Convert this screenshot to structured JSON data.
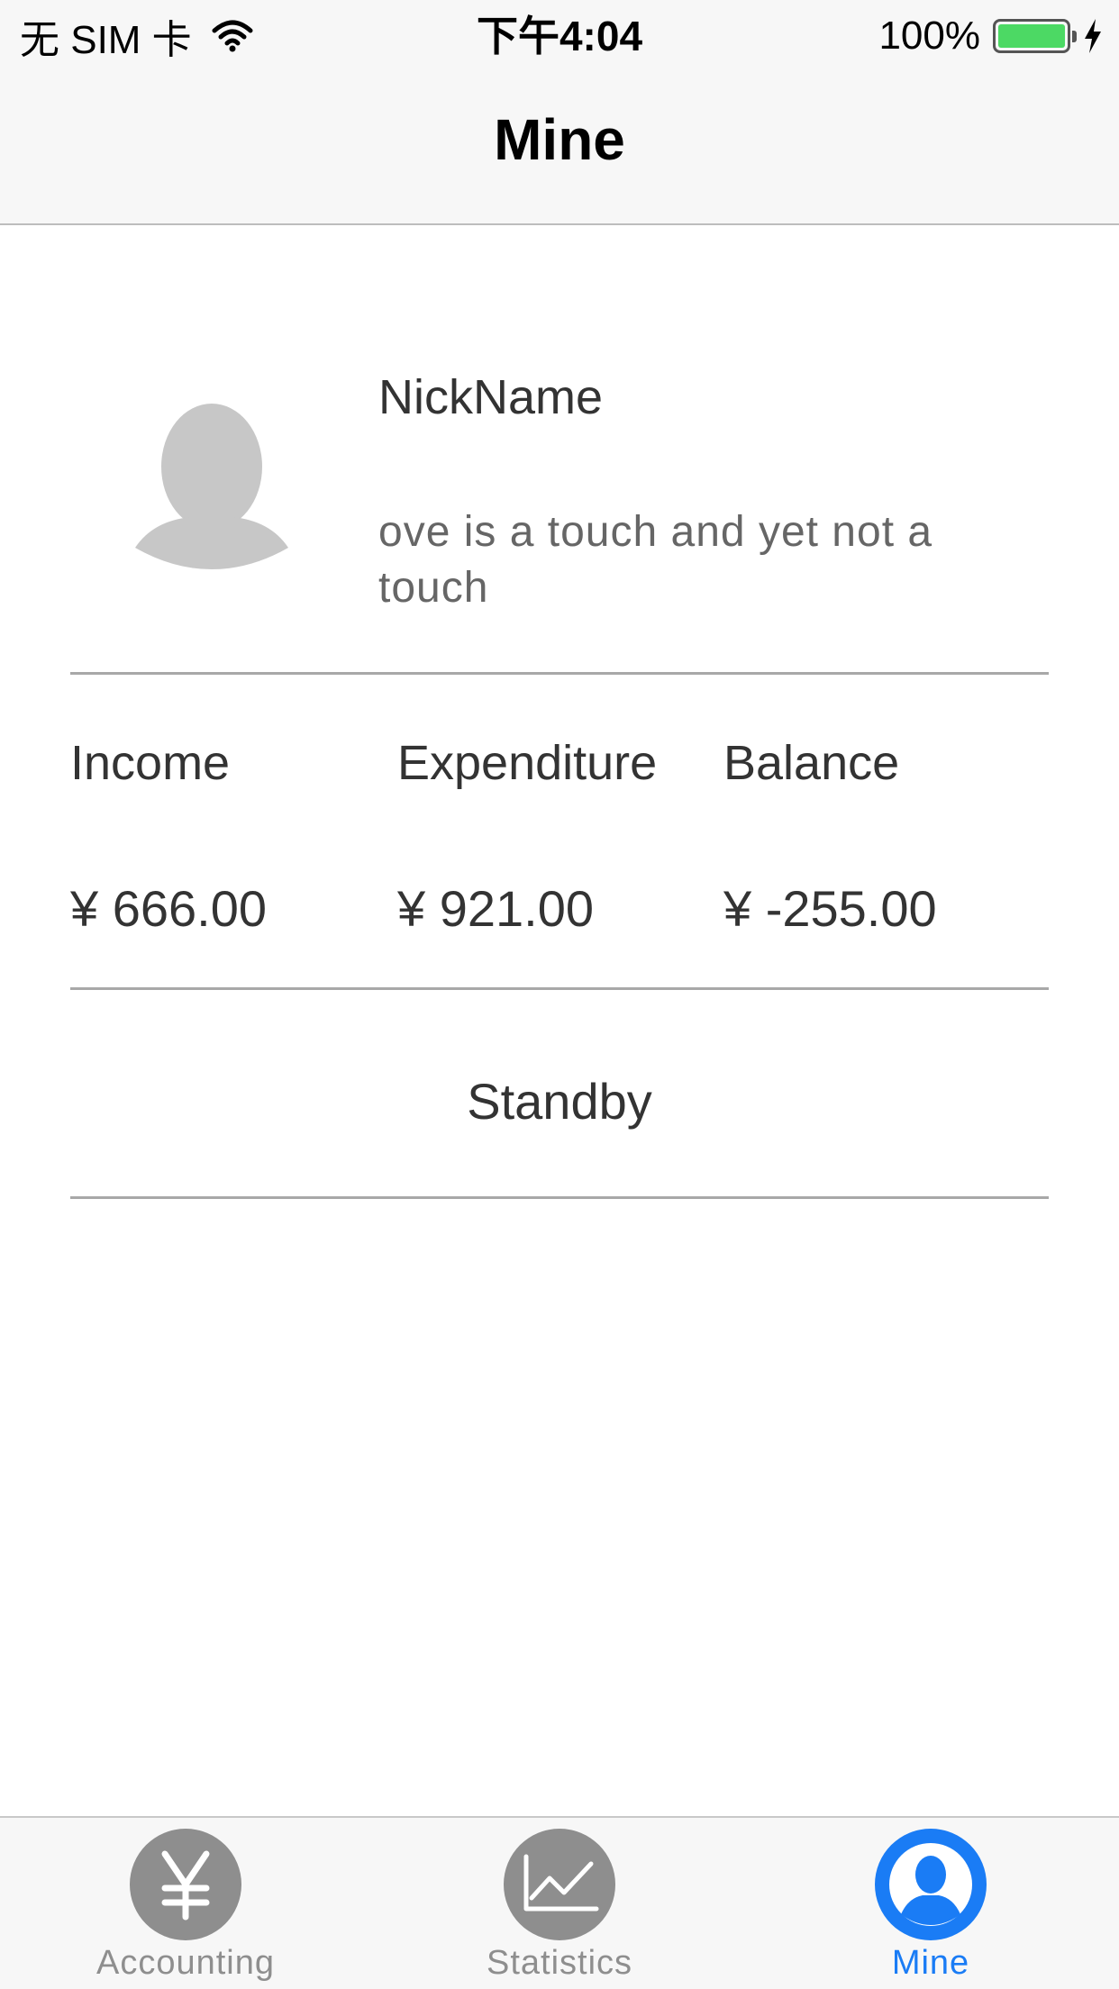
{
  "status_bar": {
    "carrier": "无 SIM 卡",
    "time": "下午4:04",
    "battery": "100%",
    "battery_level": 1.0,
    "battery_color": "#4cd964"
  },
  "nav": {
    "title": "Mine"
  },
  "profile": {
    "nickname": "NickName",
    "signature": "ove is a touch and yet not a touch"
  },
  "summary": {
    "income_label": "Income",
    "expenditure_label": "Expenditure",
    "balance_label": "Balance",
    "income_value": "¥ 666.00",
    "expenditure_value": "¥ 921.00",
    "balance_value": "¥ -255.00"
  },
  "standby_label": "Standby",
  "tab_bar": {
    "tabs": [
      {
        "label": "Accounting",
        "icon": "yen-icon",
        "selected": false
      },
      {
        "label": "Statistics",
        "icon": "chart-icon",
        "selected": false
      },
      {
        "label": "Mine",
        "icon": "person-icon",
        "selected": true
      }
    ],
    "active_color": "#1a7cf5",
    "inactive_color": "#8e8e8e"
  }
}
